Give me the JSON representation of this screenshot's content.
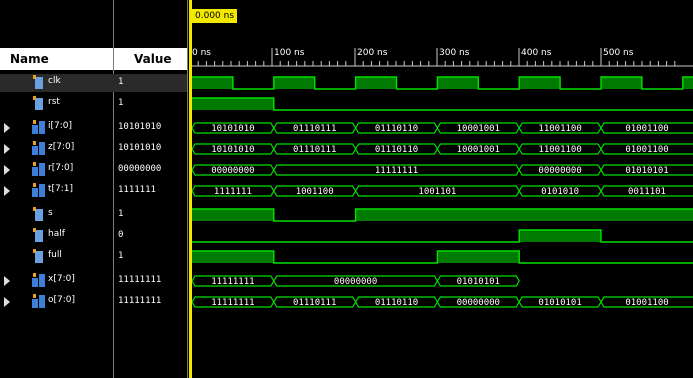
{
  "cursor": {
    "time_label": "0.000 ns"
  },
  "columns": {
    "name": "Name",
    "value": "Value"
  },
  "ruler": {
    "ticks": [
      "0 ns",
      "100 ns",
      "200 ns",
      "300 ns",
      "400 ns",
      "500 ns"
    ]
  },
  "colors": {
    "wave": "#00e000",
    "high_fill": "#007a00",
    "cursor": "#f2e800",
    "background": "#000000"
  },
  "signals": [
    {
      "name": "clk",
      "value": "1",
      "kind": "bit",
      "icon": "signal-bit-icon",
      "expandable": false,
      "segments": []
    },
    {
      "name": "rst",
      "value": "1",
      "kind": "bit",
      "icon": "signal-bit-icon",
      "expandable": false,
      "segments": []
    },
    {
      "name": "i[7:0]",
      "value": "10101010",
      "kind": "bus",
      "icon": "signal-bus-icon",
      "expandable": true,
      "segments": [
        "10101010",
        "01110111",
        "01110110",
        "10001001",
        "11001100",
        "01001100"
      ]
    },
    {
      "name": "z[7:0]",
      "value": "10101010",
      "kind": "bus",
      "icon": "signal-bus-icon",
      "expandable": true,
      "segments": [
        "10101010",
        "01110111",
        "01110110",
        "10001001",
        "11001100",
        "01001100"
      ]
    },
    {
      "name": "r[7:0]",
      "value": "00000000",
      "kind": "bus",
      "icon": "signal-bus-icon",
      "expandable": true,
      "segments": [
        "00000000",
        "11111111",
        "00000000",
        "01010101"
      ]
    },
    {
      "name": "t[7:1]",
      "value": "1111111",
      "kind": "bus",
      "icon": "signal-bus-icon",
      "expandable": true,
      "segments": [
        "1111111",
        "1001100",
        "1001101",
        "0101010",
        "0011101"
      ]
    },
    {
      "name": "s",
      "value": "1",
      "kind": "bit",
      "icon": "signal-bit-icon",
      "expandable": false,
      "segments": []
    },
    {
      "name": "half",
      "value": "0",
      "kind": "bit",
      "icon": "signal-bit-icon",
      "expandable": false,
      "segments": []
    },
    {
      "name": "full",
      "value": "1",
      "kind": "bit",
      "icon": "signal-bit-icon",
      "expandable": false,
      "segments": []
    },
    {
      "name": "x[7:0]",
      "value": "11111111",
      "kind": "bus",
      "icon": "signal-bus-icon",
      "expandable": true,
      "segments": [
        "11111111",
        "00000000",
        "01010101"
      ]
    },
    {
      "name": "o[7:0]",
      "value": "11111111",
      "kind": "bus",
      "icon": "signal-bus-icon",
      "expandable": true,
      "segments": [
        "11111111",
        "01110111",
        "01110110",
        "00000000",
        "01010101",
        "01001100"
      ]
    }
  ]
}
